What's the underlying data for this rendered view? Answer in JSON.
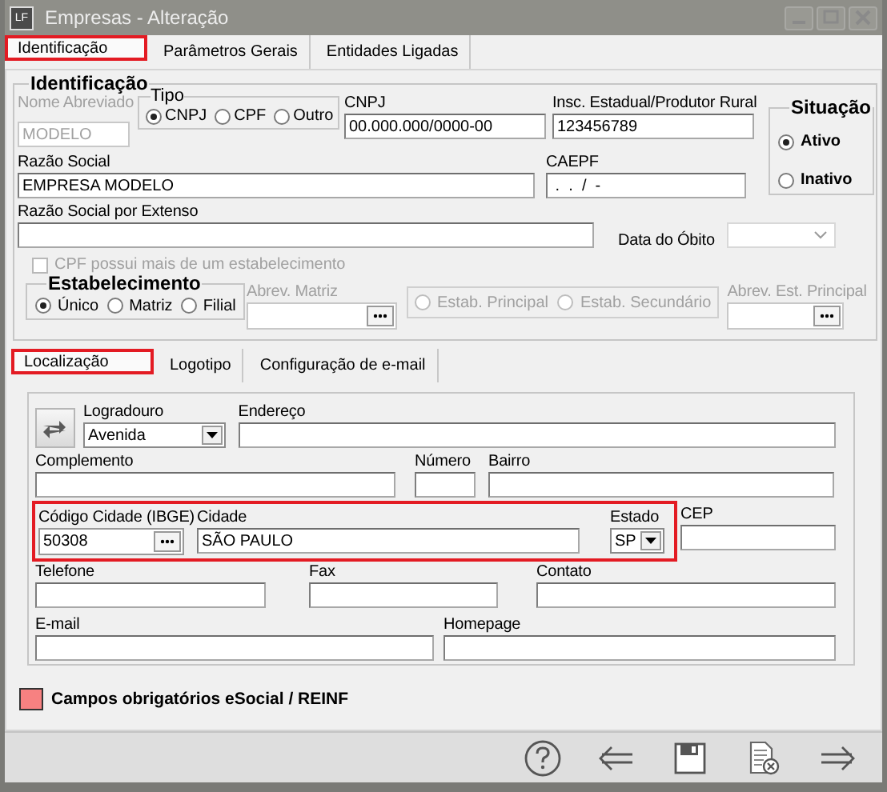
{
  "window": {
    "icon_label": "LF",
    "title": "Empresas - Alteração"
  },
  "tabs": [
    {
      "label": "Identificação",
      "selected": true,
      "highlighted": true
    },
    {
      "label": "Parâmetros Gerais",
      "selected": false,
      "highlighted": false
    },
    {
      "label": "Entidades Ligadas",
      "selected": false,
      "highlighted": false
    }
  ],
  "identificacao": {
    "title": "Identificação",
    "nome_abreviado": {
      "label": "Nome Abreviado",
      "value": "MODELO",
      "disabled": true
    },
    "tipo": {
      "title": "Tipo",
      "options": [
        {
          "label": "CNPJ",
          "selected": true
        },
        {
          "label": "CPF",
          "selected": false
        },
        {
          "label": "Outro",
          "selected": false
        }
      ]
    },
    "cnpj": {
      "label": "CNPJ",
      "value": "00.000.000/0000-00"
    },
    "inscricao": {
      "label": "Insc. Estadual/Produtor Rural",
      "value": "123456789"
    },
    "situacao": {
      "title": "Situação",
      "options": [
        {
          "label": "Ativo",
          "selected": true
        },
        {
          "label": "Inativo",
          "selected": false
        }
      ]
    },
    "razao_social": {
      "label": "Razão Social",
      "value": "EMPRESA MODELO"
    },
    "caepf": {
      "label": "CAEPF",
      "value": " .  .  /  -"
    },
    "razao_extenso": {
      "label": "Razão Social por Extenso"
    },
    "data_obito": {
      "label": "Data do Óbito",
      "disabled": true
    },
    "cpf_multiplos": {
      "label": "CPF possui mais de um estabelecimento",
      "checked": false,
      "disabled": true
    },
    "estabelecimento": {
      "title": "Estabelecimento",
      "options": [
        {
          "label": "Único",
          "selected": true
        },
        {
          "label": "Matriz",
          "selected": false
        },
        {
          "label": "Filial",
          "selected": false
        }
      ]
    },
    "abrev_matriz": {
      "label": "Abrev. Matriz",
      "disabled": true
    },
    "tipo_estab": {
      "disabled": true,
      "options": [
        {
          "label": "Estab. Principal",
          "selected": false
        },
        {
          "label": "Estab. Secundário",
          "selected": false
        }
      ]
    },
    "abrev_principal": {
      "label": "Abrev. Est. Principal",
      "disabled": true
    }
  },
  "subtabs": [
    {
      "label": "Localização",
      "selected": true,
      "highlighted": true
    },
    {
      "label": "Logotipo",
      "selected": false,
      "highlighted": false
    },
    {
      "label": "Configuração de e-mail",
      "selected": false,
      "highlighted": false
    }
  ],
  "localizacao": {
    "logradouro": {
      "label": "Logradouro",
      "value": "Avenida"
    },
    "endereco": {
      "label": "Endereço"
    },
    "complemento": {
      "label": "Complemento"
    },
    "numero": {
      "label": "Número"
    },
    "bairro": {
      "label": "Bairro"
    },
    "city_highlighted": true,
    "codigo_cidade": {
      "label": "Código Cidade (IBGE)",
      "value": "50308"
    },
    "cidade": {
      "label": "Cidade",
      "value": "SÃO PAULO"
    },
    "estado": {
      "label": "Estado",
      "value": "SP"
    },
    "cep": {
      "label": "CEP"
    },
    "telefone": {
      "label": "Telefone"
    },
    "fax": {
      "label": "Fax"
    },
    "contato": {
      "label": "Contato"
    },
    "email": {
      "label": "E-mail"
    },
    "homepage": {
      "label": "Homepage"
    }
  },
  "legend": {
    "color": "#f78181",
    "label": "Campos obrigatórios eSocial / REINF"
  },
  "toolbar": [
    {
      "kind": "help"
    },
    {
      "kind": "back"
    },
    {
      "kind": "save"
    },
    {
      "kind": "cancel"
    },
    {
      "kind": "forward"
    }
  ]
}
